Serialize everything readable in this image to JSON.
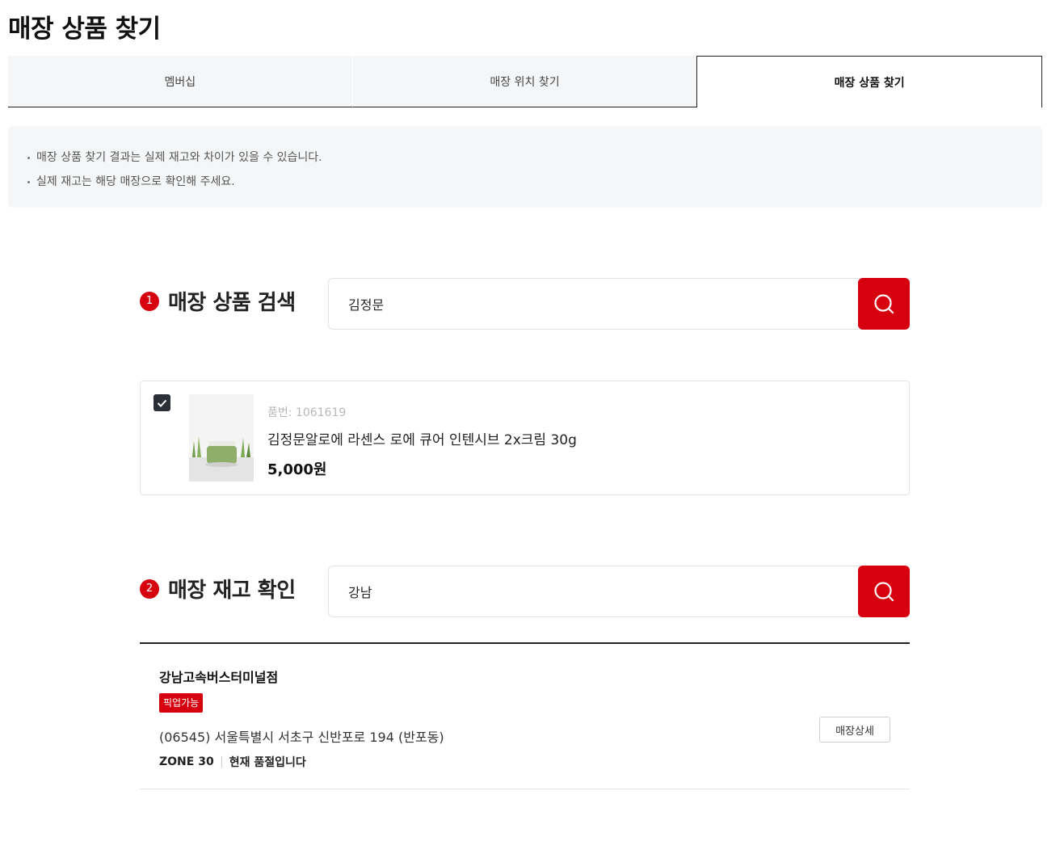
{
  "page": {
    "title": "매장 상품 찾기"
  },
  "tabs": [
    {
      "label": "멤버십",
      "active": false
    },
    {
      "label": "매장 위치 찾기",
      "active": false
    },
    {
      "label": "매장 상품 찾기",
      "active": true
    }
  ],
  "notice": [
    "매장 상품 찾기 결과는 실제 재고와 차이가 있을 수 있습니다.",
    "실제 재고는 해당 매장으로 확인해 주세요."
  ],
  "step1": {
    "number": "1",
    "label": "매장 상품 검색",
    "search_value": "김정문",
    "button_icon": "search-icon"
  },
  "product": {
    "checked": true,
    "code": "품번: 1061619",
    "name": "김정문알로에 라센스 로에 큐어 인텐시브 2x크림 30g",
    "price": "5,000원"
  },
  "step2": {
    "number": "2",
    "label": "매장 재고 확인",
    "search_value": "강남",
    "button_icon": "search-icon"
  },
  "stores": [
    {
      "name": "강남고속버스터미널점",
      "badge": "픽업가능",
      "address": "(06545) 서울특별시 서초구 신반포로 194 (반포동)",
      "zone": "ZONE 30",
      "stock_status": "현재 품절입니다",
      "detail_label": "매장상세"
    }
  ],
  "colors": {
    "accent": "#d6000f",
    "checkbox": "#2b3038",
    "notice_bg": "#f5f6f7"
  }
}
